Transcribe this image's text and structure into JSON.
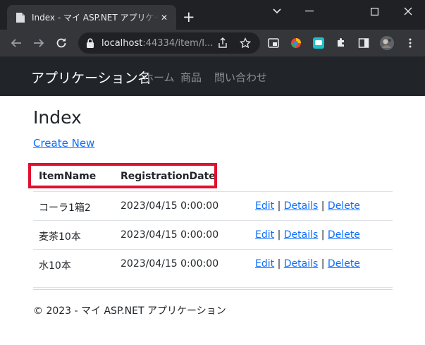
{
  "browser": {
    "tab_title": "Index - マイ ASP.NET アプリケーション",
    "tab_close": "✕",
    "new_tab": "+",
    "url_host": "localhost",
    "url_rest": ":44334/item/I...",
    "colors": {
      "frame": "#202124",
      "toolbar": "#35363a",
      "text": "#e8eaed"
    }
  },
  "navbar": {
    "brand": "アプリケーション名",
    "links": [
      "ホーム",
      "商品",
      "問い合わせ"
    ]
  },
  "page": {
    "title": "Index",
    "create_link": "Create New",
    "table": {
      "headers": [
        "ItemName",
        "RegistrationDate"
      ],
      "rows": [
        {
          "item_name": "コーラ1箱2",
          "registration_date": "2023/04/15 0:00:00"
        },
        {
          "item_name": "麦茶10本",
          "registration_date": "2023/04/15 0:00:00"
        },
        {
          "item_name": "水10本",
          "registration_date": "2023/04/15 0:00:00"
        }
      ],
      "actions": {
        "edit": "Edit",
        "details": "Details",
        "delete": "Delete",
        "separator": " | "
      }
    },
    "highlight_color": "#e0102e",
    "link_color": "#0d6efd"
  },
  "footer": {
    "text": "© 2023 - マイ ASP.NET アプリケーション"
  }
}
